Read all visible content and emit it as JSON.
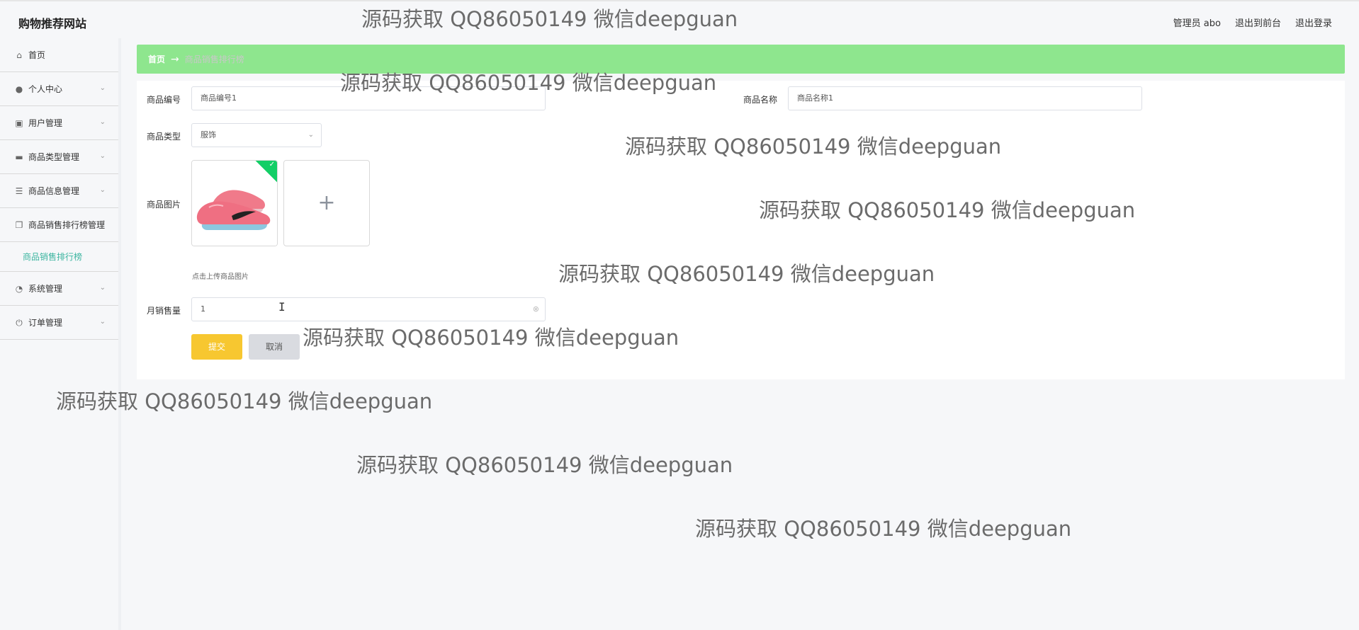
{
  "header": {
    "brand": "购物推荐网站",
    "links": [
      "管理员 abo",
      "退出到前台",
      "退出登录"
    ]
  },
  "sidebar": {
    "items": [
      {
        "label": "首页",
        "icon": "home-icon",
        "has_chevron": false
      },
      {
        "label": "个人中心",
        "icon": "user-icon",
        "has_chevron": true
      },
      {
        "label": "用户管理",
        "icon": "clipboard-icon",
        "has_chevron": true
      },
      {
        "label": "商品类型管理",
        "icon": "folder-icon",
        "has_chevron": true
      },
      {
        "label": "商品信息管理",
        "icon": "list-icon",
        "has_chevron": true
      },
      {
        "label": "商品销售排行榜管理",
        "icon": "copy-icon",
        "has_chevron": true
      },
      {
        "label": "系统管理",
        "icon": "gauge-icon",
        "has_chevron": true
      },
      {
        "label": "订单管理",
        "icon": "power-icon",
        "has_chevron": true
      }
    ],
    "active_sub": "商品销售排行榜"
  },
  "breadcrumb": {
    "home": "首页",
    "separator": "→",
    "current": "商品销售排行榜"
  },
  "form": {
    "product_code_label": "商品编号",
    "product_code_value": "商品编号1",
    "product_name_label": "商品名称",
    "product_name_value": "商品名称1",
    "product_type_label": "商品类型",
    "product_type_value": "服饰",
    "product_image_label": "商品图片",
    "upload_hint": "点击上传商品图片",
    "monthly_sales_label": "月销售量",
    "monthly_sales_value": "1",
    "submit_label": "提交",
    "cancel_label": "取消"
  },
  "watermark_text": "源码获取 QQ86050149 微信deepguan",
  "colors": {
    "breadcrumb_bg": "#8ee68e",
    "active_sub": "#3cb5a0",
    "submit": "#f7c730",
    "cancel": "#d9dbe0",
    "upload_check": "#13ce66"
  }
}
